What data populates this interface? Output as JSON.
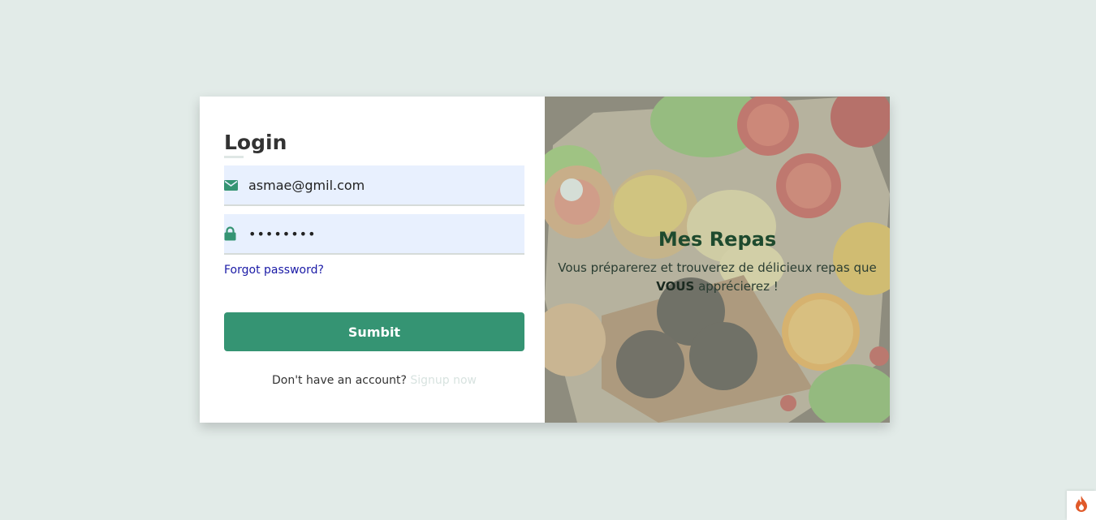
{
  "login": {
    "title": "Login",
    "email": {
      "value": "asmae@gmil.com",
      "icon": "envelope-icon"
    },
    "password": {
      "value": "••••••••",
      "icon": "lock-icon"
    },
    "forgot_label": "Forgot password?",
    "submit_label": "Sumbit",
    "signup_prompt": "Don't have an account?",
    "signup_link": "Signup now"
  },
  "hero": {
    "title": "Mes Repas",
    "text_before": "Vous préparerez et trouverez de délicieux repas que",
    "text_emphasis": "VOUS",
    "text_after": "apprécierez !"
  },
  "colors": {
    "background": "#e2ebe8",
    "accent": "#359473",
    "link": "#1a1aa6",
    "field_bg": "#e8f0fe"
  },
  "corner_badge": {
    "icon": "flame-icon"
  }
}
